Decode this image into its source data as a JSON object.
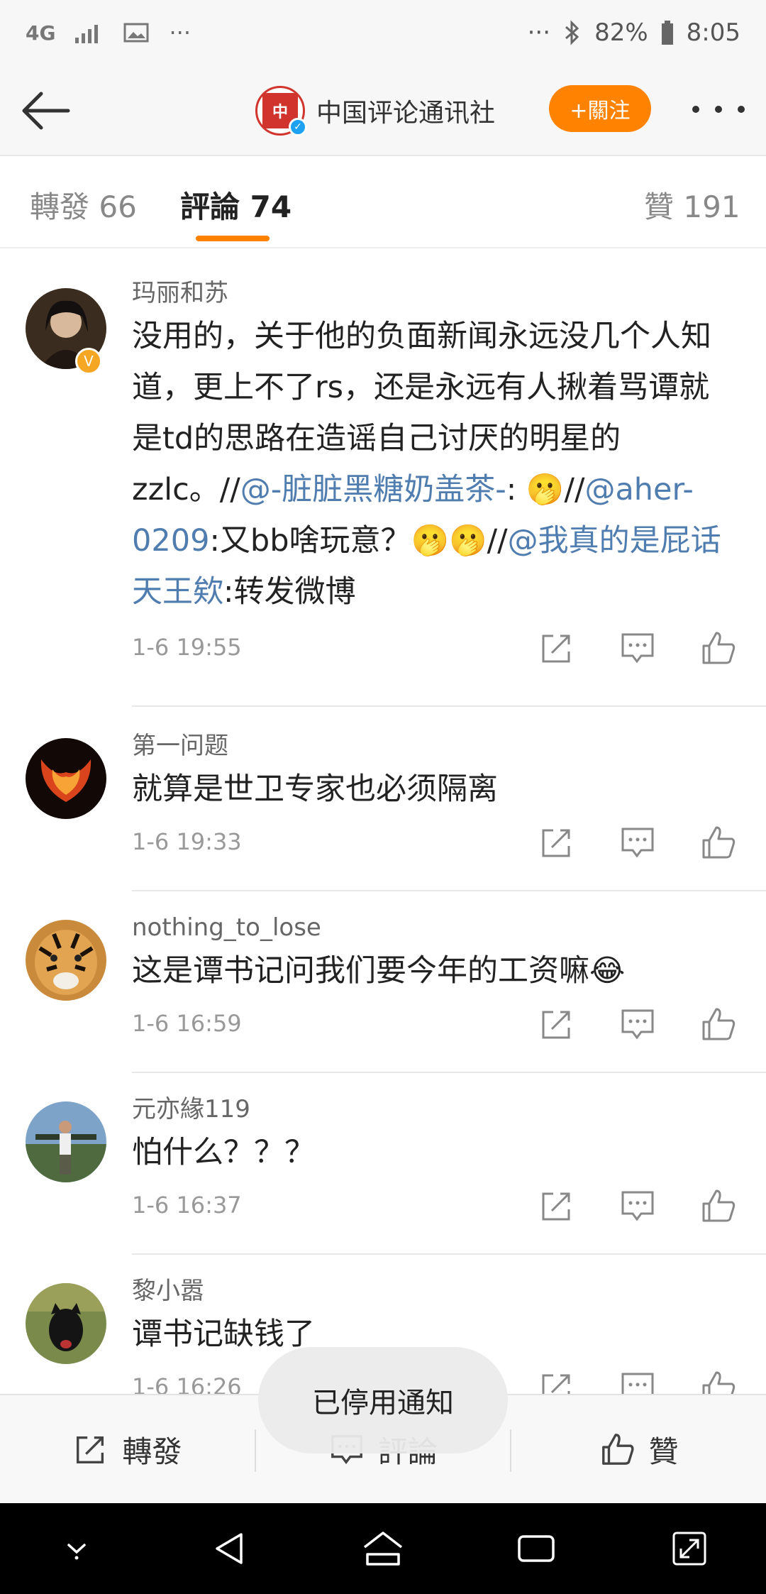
{
  "status_bar": {
    "network": "4G",
    "dots_left": "···",
    "dots_right": "···",
    "battery": "82%",
    "time": "8:05"
  },
  "header": {
    "title": "中国评论通讯社",
    "follow_label": "+關注"
  },
  "tabs": [
    {
      "label": "轉發",
      "count": "66"
    },
    {
      "label": "評論",
      "count": "74"
    },
    {
      "label": "贊",
      "count": "191"
    }
  ],
  "comments": [
    {
      "username": "玛丽和苏",
      "text_parts": [
        "没用的，关于他的负面新闻永远没几个人知道，更上不了rs，还是永远有人揪着骂谭就是td的思路在造谣自己讨厌的明星的zzlc。//",
        "@-脏脏黑糖奶盖茶-",
        ": 🫢//",
        "@aher-0209",
        ":又bb啥玩意？🫢🫢//",
        "@我真的是屁话天王欸",
        ":转发微博"
      ],
      "time": "1-6 19:55"
    },
    {
      "username": "第一问题",
      "text": "就算是世卫专家也必须隔离",
      "time": "1-6 19:33"
    },
    {
      "username": "nothing_to_lose",
      "text": "这是谭书记问我们要今年的工资嘛😂",
      "time": "1-6 16:59"
    },
    {
      "username": "元亦緣119",
      "text": "怕什么？？？",
      "time": "1-6 16:37"
    },
    {
      "username": "黎小嚣",
      "text": "谭书记缺钱了",
      "time": "1-6 16:26"
    }
  ],
  "bottom_bar": {
    "repost": "轉發",
    "comment": "評論",
    "like": "贊"
  },
  "toast": "已停用通知",
  "colors": {
    "accent": "#ff8200",
    "mention": "#507daf"
  }
}
